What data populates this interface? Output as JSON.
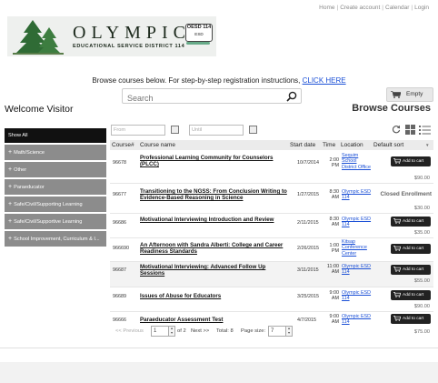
{
  "top_nav": {
    "home": "Home",
    "create_account": "Create account",
    "calendar": "Calendar",
    "login": "Login",
    "separator": "|"
  },
  "logo": {
    "name": "OLYMPIC",
    "subtitle": "EDUCATIONAL SERVICE DISTRICT 114",
    "seal_line1": "OESD 114",
    "seal_line2": "ESD"
  },
  "instructions": {
    "text": "Browse courses below. For  step-by-step registration instructions, ",
    "link": "CLICK HERE"
  },
  "search": {
    "placeholder": "Search",
    "icon": "magnifier-icon"
  },
  "cart": {
    "label": "Empty",
    "icon": "shopping-cart-icon"
  },
  "welcome": "Welcome Visitor",
  "browse_title": "Browse Courses",
  "sidebar": {
    "items": [
      {
        "label": "Show All",
        "prefix": "",
        "active": true
      },
      {
        "label": "Math/Science",
        "prefix": "+"
      },
      {
        "label": "Other",
        "prefix": "+"
      },
      {
        "label": "Paraeducator",
        "prefix": "+"
      },
      {
        "label": "Safe/Civil/Supporting Learning",
        "prefix": "+"
      },
      {
        "label": "Safe/Civil/Supportive Learning",
        "prefix": "+"
      },
      {
        "label": "School Improvement, Curriculum & I...",
        "prefix": "+"
      }
    ]
  },
  "filters": {
    "from_placeholder": "From",
    "until_placeholder": "Until"
  },
  "table": {
    "headers": {
      "num": "Course#",
      "name": "Course name",
      "start": "Start date",
      "time": "Time",
      "location": "Location",
      "sort": "Default sort"
    },
    "add_label": "Add to cart",
    "rows": [
      {
        "num": "96678",
        "name": "Professional Learning Community for Counselors (PLCC)",
        "date": "10/7/2014",
        "time": "2:00 PM",
        "location": "Sequim School District Office",
        "price": "$90.00",
        "status": "add"
      },
      {
        "num": "96677",
        "name": "Transitioning to the NGSS: From Conclusion Writing to Evidence-Based Reasoning in Science",
        "date": "1/27/2015",
        "time": "8:30 AM",
        "location": "Olympic ESD 114",
        "price": "$30.00",
        "status": "closed",
        "status_text": "Closed Enrollment"
      },
      {
        "num": "96686",
        "name": "Motivational Interviewing Introduction and Review",
        "date": "2/11/2015",
        "time": "8:30 AM",
        "location": "Olympic ESD 114",
        "price": "$35.00",
        "status": "add"
      },
      {
        "num": "966690",
        "name": "An Afternoon with Sandra Alberti: College and Career Readiness Standards",
        "date": "2/26/2015",
        "time": "1:00 PM",
        "location": "Kitsap Conference Center",
        "price": "",
        "status": "add"
      },
      {
        "num": "96687",
        "name": "Motivational Interviewing: Advanced Follow Up Sessions",
        "date": "3/11/2015",
        "time": "11:00 AM",
        "location": "Olympic ESD 114",
        "price": "$55.00",
        "status": "add"
      },
      {
        "num": "96689",
        "name": "Issues of Abuse for Educators",
        "date": "3/25/2015",
        "time": "9:00 AM",
        "location": "Olympic ESD 114",
        "price": "$90.00",
        "status": "add"
      },
      {
        "num": "96666",
        "name": "Paraeducator Assessment Test",
        "date": "4/7/2015",
        "time": "9:00 AM",
        "location": "Olympic ESD 114",
        "price": "$75.00",
        "status": "add"
      }
    ]
  },
  "pager": {
    "prev": "<< Previous",
    "page": "1",
    "of": "of 2",
    "next": "Next >>",
    "total": "Total: 8",
    "size_label": "Page size:",
    "size": "7"
  }
}
